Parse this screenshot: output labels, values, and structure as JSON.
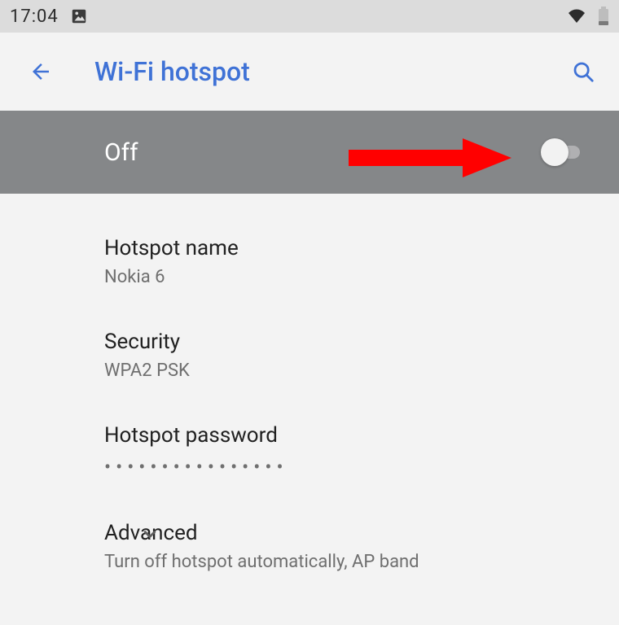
{
  "status": {
    "time": "17:04"
  },
  "appbar": {
    "title": "Wi-Fi hotspot"
  },
  "toggle": {
    "state_label": "Off"
  },
  "items": {
    "name": {
      "title": "Hotspot name",
      "value": "Nokia 6"
    },
    "security": {
      "title": "Security",
      "value": "WPA2 PSK"
    },
    "password": {
      "title": "Hotspot password"
    },
    "advanced": {
      "title": "Advanced",
      "value": "Turn off hotspot automatically, AP band"
    }
  },
  "colors": {
    "accent": "#3f72d6",
    "annotation": "#ff0000"
  }
}
